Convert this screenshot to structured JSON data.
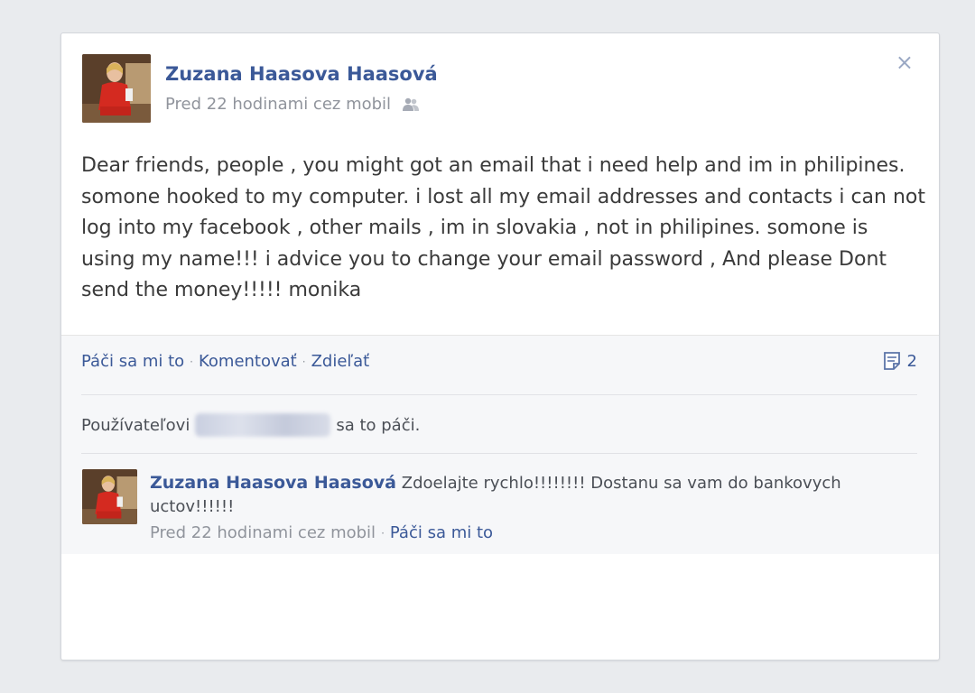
{
  "post": {
    "author": "Zuzana Haasova Haasová",
    "meta": "Pred 22 hodinami cez mobil",
    "audience_icon": "friends-icon",
    "close_label": "×",
    "text": "Dear friends, people , you might got an email that i need help and im in philipines. somone hooked to my computer. i lost all my email addresses and contacts i can not log into my facebook , other mails , im in slovakia , not in philipines. somone is using my name!!! i advice you to change your email password , And please Dont send the money!!!!! monika"
  },
  "actions": {
    "like": "Páči sa mi to",
    "comment": "Komentovať",
    "share": "Zdieľať",
    "separator": "·",
    "comments_count": "2",
    "comments_icon": "comment-icon"
  },
  "likes": {
    "prefix": "Používateľovi",
    "suffix": "sa to páči."
  },
  "comment": {
    "author": "Zuzana Haasova Haasová",
    "text": "Zdoelajte rychlo!!!!!!!! Dostanu sa vam do bankovych uctov!!!!!!",
    "meta": "Pred 22 hodinami cez mobil",
    "like": "Páči sa mi to",
    "separator": "·"
  },
  "colors": {
    "link": "#3b5998",
    "muted": "#90949c",
    "background": "#e9ebee"
  }
}
